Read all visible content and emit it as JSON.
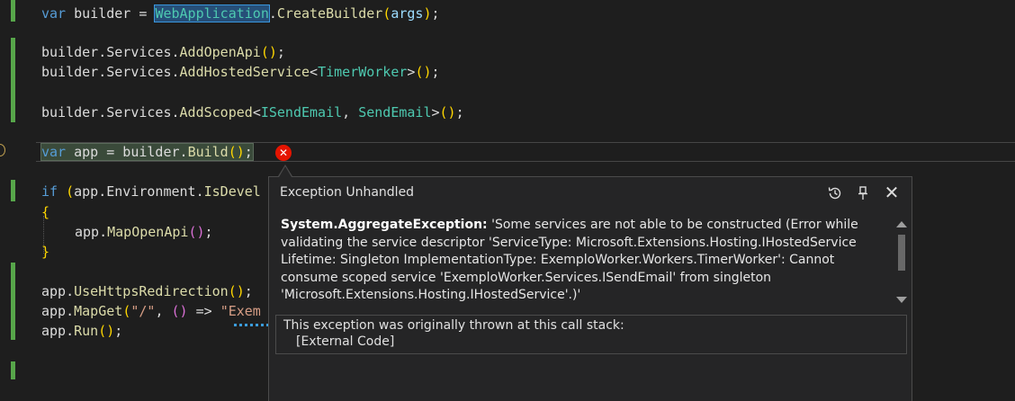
{
  "code": {
    "line1": {
      "kw": "var",
      "name": " builder = ",
      "type": "WebApplication",
      "dot": ".",
      "fn": "CreateBuilder",
      "open": "(",
      "arg": "args",
      "close": ")",
      "end": ";"
    },
    "line2": {
      "obj": "builder.Services.",
      "fn": "AddOpenApi",
      "parens": "()",
      "end": ";"
    },
    "line3": {
      "obj": "builder.Services.",
      "fn": "AddHostedService",
      "lt": "<",
      "type": "TimerWorker",
      "gt": ">",
      "parens": "()",
      "end": ";"
    },
    "line4": {
      "obj": "builder.Services.",
      "fn": "AddScoped",
      "lt": "<",
      "type1": "ISendEmail",
      "comma": ", ",
      "type2": "SendEmail",
      "gt": ">",
      "parens": "()",
      "end": ";"
    },
    "line5": {
      "kw": "var",
      "mid": " app = builder.",
      "fn": "Build",
      "parens": "()",
      "end": ";"
    },
    "line6": {
      "kw": "if",
      "open": " (",
      "obj": "app.Environment.",
      "fn": "IsDevel"
    },
    "line7": {
      "brace": "{"
    },
    "line8": {
      "obj": "app.",
      "fn": "MapOpenApi",
      "parens": "()",
      "end": ";"
    },
    "line9": {
      "brace": "}"
    },
    "line10": {
      "obj": "app.",
      "fn": "UseHttpsRedirection",
      "parens": "()",
      "end": ";"
    },
    "line11": {
      "obj": "app.",
      "fn": "MapGet",
      "open": "(",
      "str": "\"/\"",
      "mid": ", ",
      "lambda": "()",
      "arrow": " => ",
      "str2": "\"Exem"
    },
    "line12": {
      "obj": "app.",
      "fn": "Run",
      "parens": "()",
      "end": ";"
    }
  },
  "error_icon": {
    "glyph": "✕",
    "icon": "error-circle-icon",
    "color": "#e51400"
  },
  "exception": {
    "title": "Exception Unhandled",
    "exception_type": "System.AggregateException:",
    "message": " 'Some services are not able to be constructed (Error while validating the service descriptor 'ServiceType: Microsoft.Extensions.Hosting.IHostedService Lifetime: Singleton ImplementationType: ExemploWorker.Workers.TimerWorker': Cannot consume scoped service 'ExemploWorker.Services.ISendEmail' from singleton 'Microsoft.Extensions.Hosting.IHostedService'.)'",
    "stack_heading": "This exception was originally thrown at this call stack:",
    "stack_frame": "[External Code]",
    "close_glyph": "✕",
    "buttons": [
      "history-icon",
      "pin-icon",
      "close-icon"
    ]
  },
  "colors": {
    "background": "#1e1e1e",
    "keyword": "#569cd6",
    "type": "#4ec9b0",
    "method": "#dcdcaa",
    "string": "#d69d85",
    "change_bar": "#57a64a"
  }
}
